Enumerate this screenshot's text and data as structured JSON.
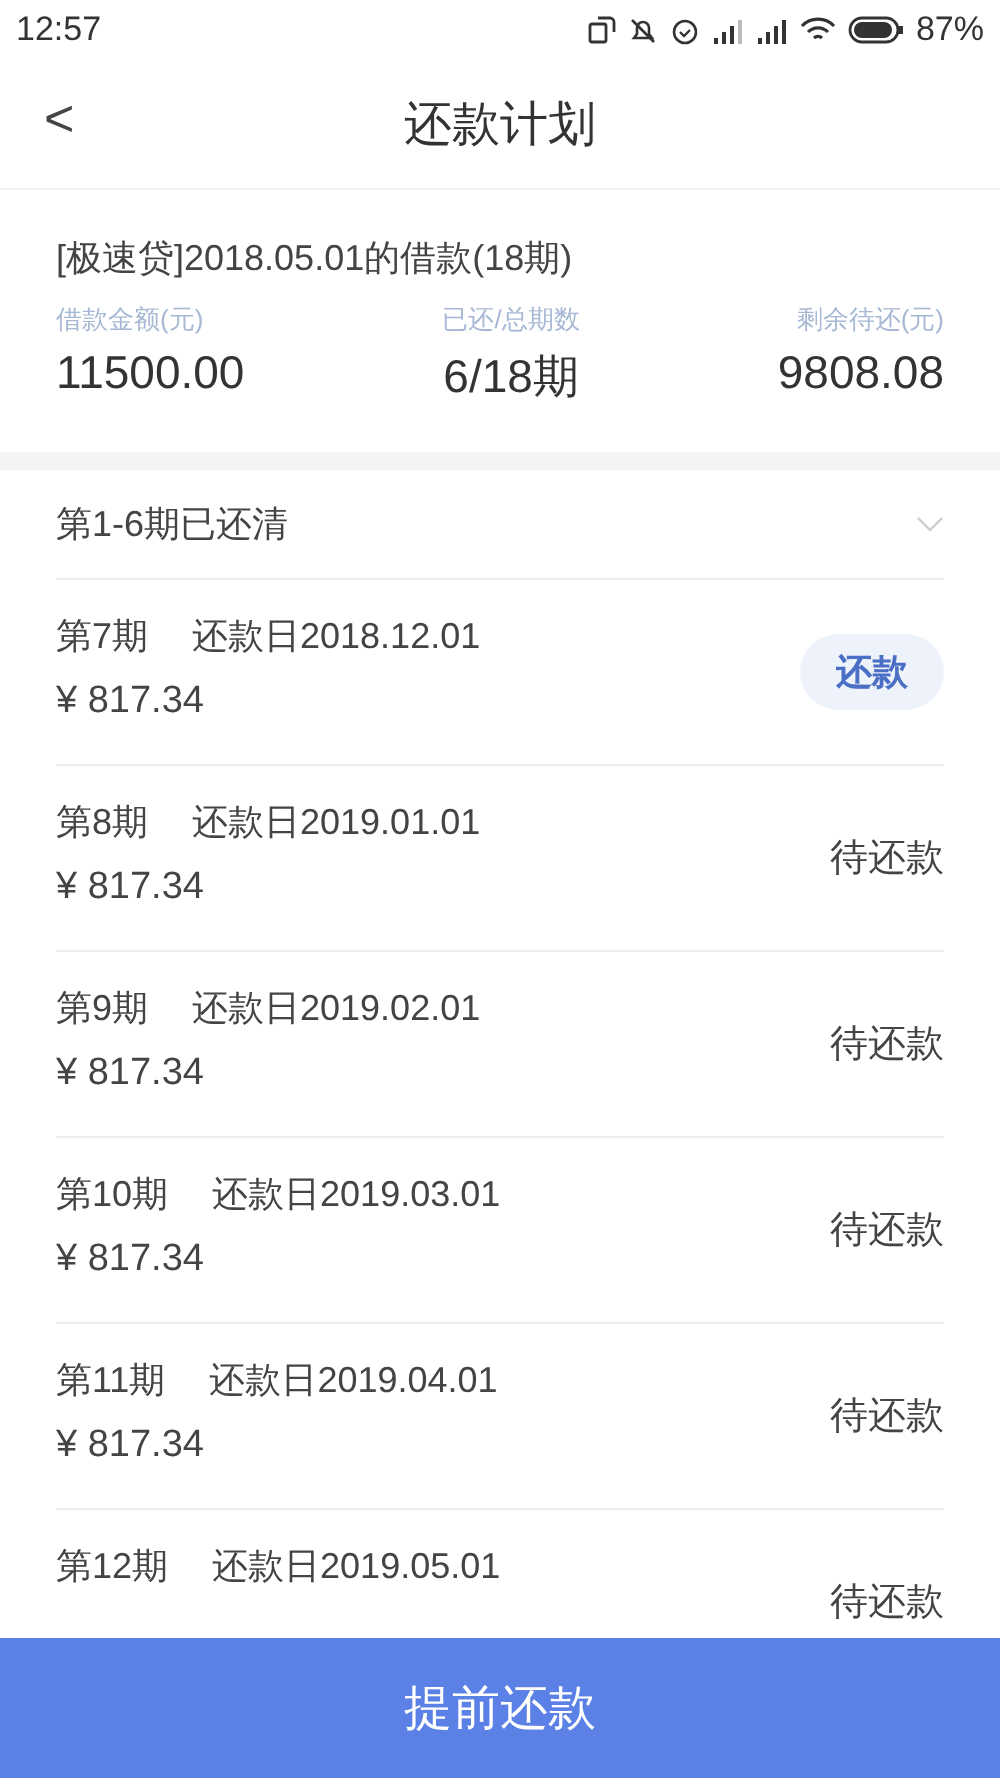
{
  "status_bar": {
    "time": "12:57",
    "battery": "87%"
  },
  "header": {
    "back": "<",
    "title": "还款计划"
  },
  "loan": {
    "title": "[极速贷]2018.05.01的借款(18期)",
    "stats": [
      {
        "label": "借款金额(元)",
        "value": "11500.00"
      },
      {
        "label": "已还/总期数",
        "value": "6/18期"
      },
      {
        "label": "剩余待还(元)",
        "value": "9808.08"
      }
    ]
  },
  "paid_summary": {
    "label": "第1-6期已还清",
    "expanded": false
  },
  "installments": [
    {
      "period": "第7期",
      "due": "还款日2018.12.01",
      "amount": "¥ 817.34",
      "action": "还款",
      "kind": "button"
    },
    {
      "period": "第8期",
      "due": "还款日2019.01.01",
      "amount": "¥ 817.34",
      "action": "待还款",
      "kind": "text"
    },
    {
      "period": "第9期",
      "due": "还款日2019.02.01",
      "amount": "¥ 817.34",
      "action": "待还款",
      "kind": "text"
    },
    {
      "period": "第10期",
      "due": "还款日2019.03.01",
      "amount": "¥ 817.34",
      "action": "待还款",
      "kind": "text"
    },
    {
      "period": "第11期",
      "due": "还款日2019.04.01",
      "amount": "¥ 817.34",
      "action": "待还款",
      "kind": "text"
    },
    {
      "period": "第12期",
      "due": "还款日2019.05.01",
      "action": "待还款",
      "kind": "text"
    }
  ],
  "footer_button": "提前还款"
}
